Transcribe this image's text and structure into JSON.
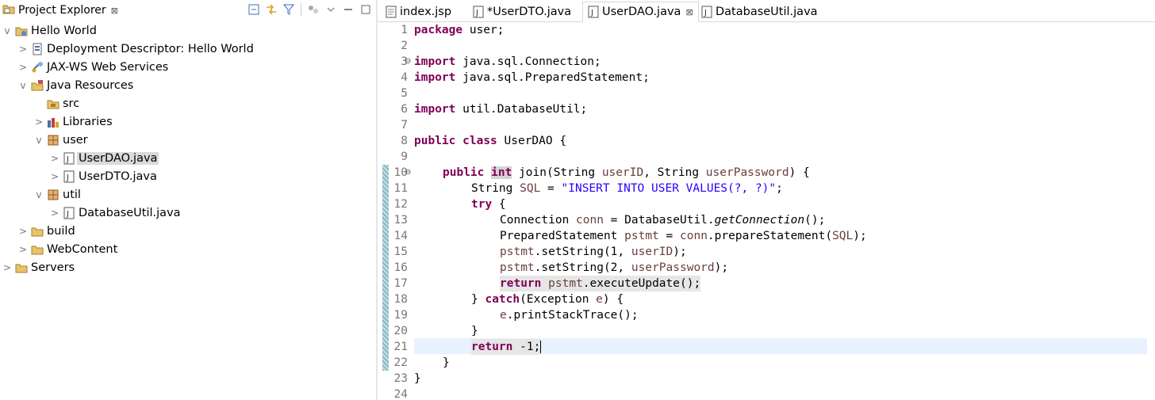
{
  "explorer": {
    "title": "Project Explorer",
    "tree": [
      {
        "label": "Hello World",
        "arrow": "v",
        "icon": "project-icon",
        "depth": 0
      },
      {
        "label": "Deployment Descriptor: Hello World",
        "arrow": ">",
        "icon": "deployment-descriptor-icon",
        "depth": 1
      },
      {
        "label": "JAX-WS Web Services",
        "arrow": ">",
        "icon": "web-services-icon",
        "depth": 1
      },
      {
        "label": "Java Resources",
        "arrow": "v",
        "icon": "java-resources-icon",
        "depth": 1
      },
      {
        "label": "src",
        "arrow": "",
        "icon": "source-folder-icon",
        "depth": 2
      },
      {
        "label": "Libraries",
        "arrow": ">",
        "icon": "libraries-icon",
        "depth": 2
      },
      {
        "label": "user",
        "arrow": "v",
        "icon": "package-icon",
        "depth": 2
      },
      {
        "label": "UserDAO.java",
        "arrow": ">",
        "icon": "java-file-icon",
        "depth": 3,
        "selected": true
      },
      {
        "label": "UserDTO.java",
        "arrow": ">",
        "icon": "java-file-icon",
        "depth": 3
      },
      {
        "label": "util",
        "arrow": "v",
        "icon": "package-icon",
        "depth": 2
      },
      {
        "label": "DatabaseUtil.java",
        "arrow": ">",
        "icon": "java-file-icon",
        "depth": 3
      },
      {
        "label": "build",
        "arrow": ">",
        "icon": "folder-icon",
        "depth": 1
      },
      {
        "label": "WebContent",
        "arrow": ">",
        "icon": "folder-icon",
        "depth": 1
      },
      {
        "label": "Servers",
        "arrow": ">",
        "icon": "servers-icon",
        "depth": 0
      }
    ]
  },
  "editor": {
    "tabs": [
      {
        "label": "index.jsp",
        "icon": "jsp-file-icon"
      },
      {
        "label": "*UserDTO.java",
        "icon": "java-file-icon"
      },
      {
        "label": "UserDAO.java",
        "icon": "java-file-icon",
        "active": true
      },
      {
        "label": "DatabaseUtil.java",
        "icon": "java-file-icon"
      }
    ],
    "line_numbers": [
      "1",
      "2",
      "3",
      "4",
      "5",
      "6",
      "7",
      "8",
      "9",
      "10",
      "11",
      "12",
      "13",
      "14",
      "15",
      "16",
      "17",
      "18",
      "19",
      "20",
      "21",
      "22",
      "23",
      "24"
    ],
    "fold_lines": [
      "3",
      "10"
    ],
    "current_line": "21"
  },
  "code": {
    "l1_kw": "package",
    "l1_rest": " user;",
    "l3_kw": "import",
    "l3_rest": " java.sql.Connection;",
    "l4_kw": "import",
    "l4_rest": " java.sql.PreparedStatement;",
    "l6_kw": "import",
    "l6_rest": " util.DatabaseUtil;",
    "l8_kw1": "public",
    "l8_kw2": "class",
    "l8_rest": " UserDAO {",
    "l10_kw1": "public",
    "l10_kw2": "int",
    "l10_a": " join(String ",
    "l10_v1": "userID",
    "l10_b": ", String ",
    "l10_v2": "userPassword",
    "l10_c": ") {",
    "l11_a": "String ",
    "l11_v": "SQL",
    "l11_b": " = ",
    "l11_str": "\"INSERT INTO USER VALUES(?, ?)\"",
    "l11_c": ";",
    "l12_kw": "try",
    "l12_rest": " {",
    "l13_a": "Connection ",
    "l13_v": "conn",
    "l13_b": " = DatabaseUtil.",
    "l13_it": "getConnection",
    "l13_c": "();",
    "l14_a": "PreparedStatement ",
    "l14_v": "pstmt",
    "l14_b": " = ",
    "l14_v2": "conn",
    "l14_c": ".prepareStatement(",
    "l14_v3": "SQL",
    "l14_d": ");",
    "l15_v": "pstmt",
    "l15_a": ".setString(1, ",
    "l15_v2": "userID",
    "l15_b": ");",
    "l16_v": "pstmt",
    "l16_a": ".setString(2, ",
    "l16_v2": "userPassword",
    "l16_b": ");",
    "l17_kw": "return",
    "l17_sp": " ",
    "l17_v": "pstmt",
    "l17_a": ".executeUpdate();",
    "l18_a": "} ",
    "l18_kw": "catch",
    "l18_b": "(Exception ",
    "l18_v": "e",
    "l18_c": ") {",
    "l19_v": "e",
    "l19_a": ".printStackTrace();",
    "l20": "}",
    "l21_kw": "return",
    "l21_a": " -1;",
    "l22": "}",
    "l23": "}"
  }
}
